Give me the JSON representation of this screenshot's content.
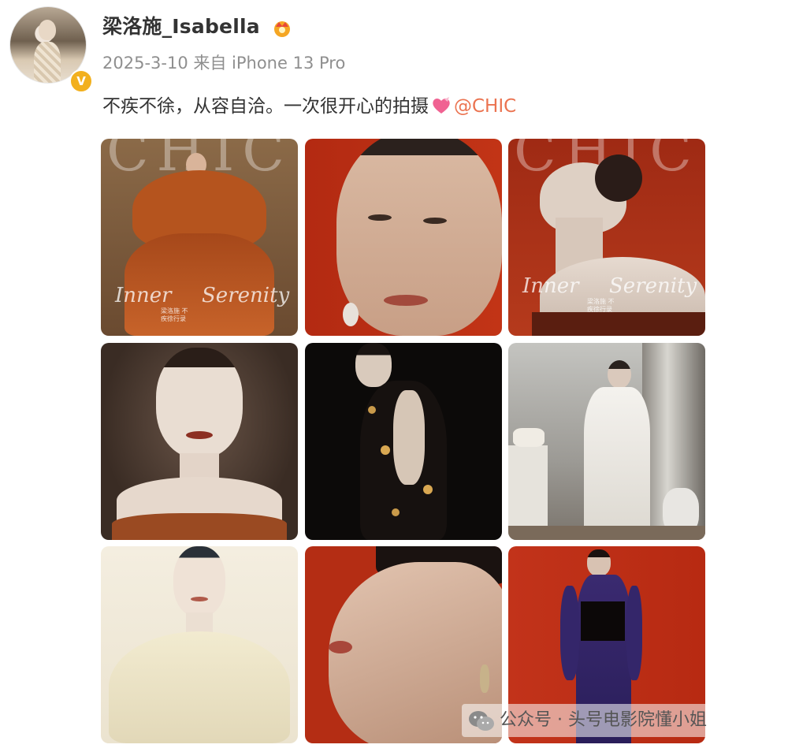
{
  "post": {
    "username": "梁洛施_Isabella",
    "meta": "2025-3-10 来自 iPhone 13 Pro",
    "text": "不疾不徐，从容自洽。一次很开心的拍摄",
    "mention": "@CHIC"
  },
  "icons": {
    "verified": "verified-badge-icon",
    "vip": "crown-icon",
    "heart": "heart-icon",
    "watermark": "wechat-icon"
  },
  "colors": {
    "mention": "#eb7350",
    "meta": "#8f8f8f",
    "verified": "#f2b01e"
  },
  "photos": {
    "cover1": {
      "title": "CHIC",
      "left_word": "Inner",
      "right_word": "Serenity",
      "sub": "梁洛施 不疾徐行录"
    },
    "cover3": {
      "title": "CHIC",
      "left_word": "Inner",
      "right_word": "Serenity",
      "sub": "梁洛施 不疾徐行录"
    }
  },
  "watermark": {
    "text": "公众号 · 头号电影院懂小姐"
  }
}
